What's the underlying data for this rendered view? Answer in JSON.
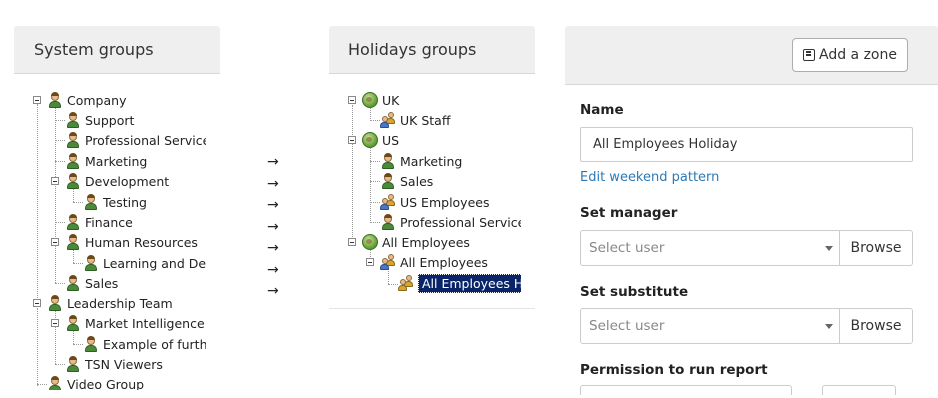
{
  "system_groups": {
    "title": "System groups",
    "nodes": [
      {
        "label": "Company",
        "icon": "user-icon"
      },
      {
        "label": "Support",
        "icon": "user-icon"
      },
      {
        "label": "Professional Service",
        "icon": "user-icon"
      },
      {
        "label": "Marketing",
        "icon": "user-icon"
      },
      {
        "label": "Development",
        "icon": "user-icon"
      },
      {
        "label": "Testing",
        "icon": "user-icon"
      },
      {
        "label": "Finance",
        "icon": "user-icon"
      },
      {
        "label": "Human Resources",
        "icon": "user-icon"
      },
      {
        "label": "Learning and De",
        "icon": "user-icon"
      },
      {
        "label": "Sales",
        "icon": "user-icon"
      },
      {
        "label": "Leadership Team",
        "icon": "user-icon"
      },
      {
        "label": "Market Intelligence",
        "icon": "user-icon"
      },
      {
        "label": "Example of furth",
        "icon": "user-icon"
      },
      {
        "label": "TSN Viewers",
        "icon": "user-icon"
      },
      {
        "label": "Video Group",
        "icon": "user-icon"
      }
    ]
  },
  "arrows": [
    "→",
    "→",
    "→",
    "→",
    "→",
    "→",
    "→"
  ],
  "holidays_groups": {
    "title": "Holidays groups",
    "nodes": [
      {
        "label": "UK",
        "icon": "globe-icon"
      },
      {
        "label": "UK Staff",
        "icon": "group-icon"
      },
      {
        "label": "US",
        "icon": "globe-icon"
      },
      {
        "label": "Marketing",
        "icon": "user-icon"
      },
      {
        "label": "Sales",
        "icon": "user-icon"
      },
      {
        "label": "US Employees",
        "icon": "group-icon"
      },
      {
        "label": "Professional Service",
        "icon": "user-icon"
      },
      {
        "label": "All Employees",
        "icon": "globe-icon"
      },
      {
        "label": "All Employees",
        "icon": "group-icon"
      },
      {
        "label": "All Employees Ho",
        "icon": "group-icon",
        "selected": true
      }
    ]
  },
  "form": {
    "add_zone_label": "Add a zone",
    "name_label": "Name",
    "name_value": "All Employees Holiday",
    "edit_weekend_link": "Edit weekend pattern",
    "set_manager_label": "Set manager",
    "set_manager_placeholder": "Select user",
    "set_substitute_label": "Set substitute",
    "set_substitute_placeholder": "Select user",
    "browse_label": "Browse",
    "permission_label": "Permission to run report"
  },
  "colors": {
    "selection_bg": "#0a246a",
    "link": "#2a7ab8",
    "panel_header_bg": "#efefef"
  }
}
